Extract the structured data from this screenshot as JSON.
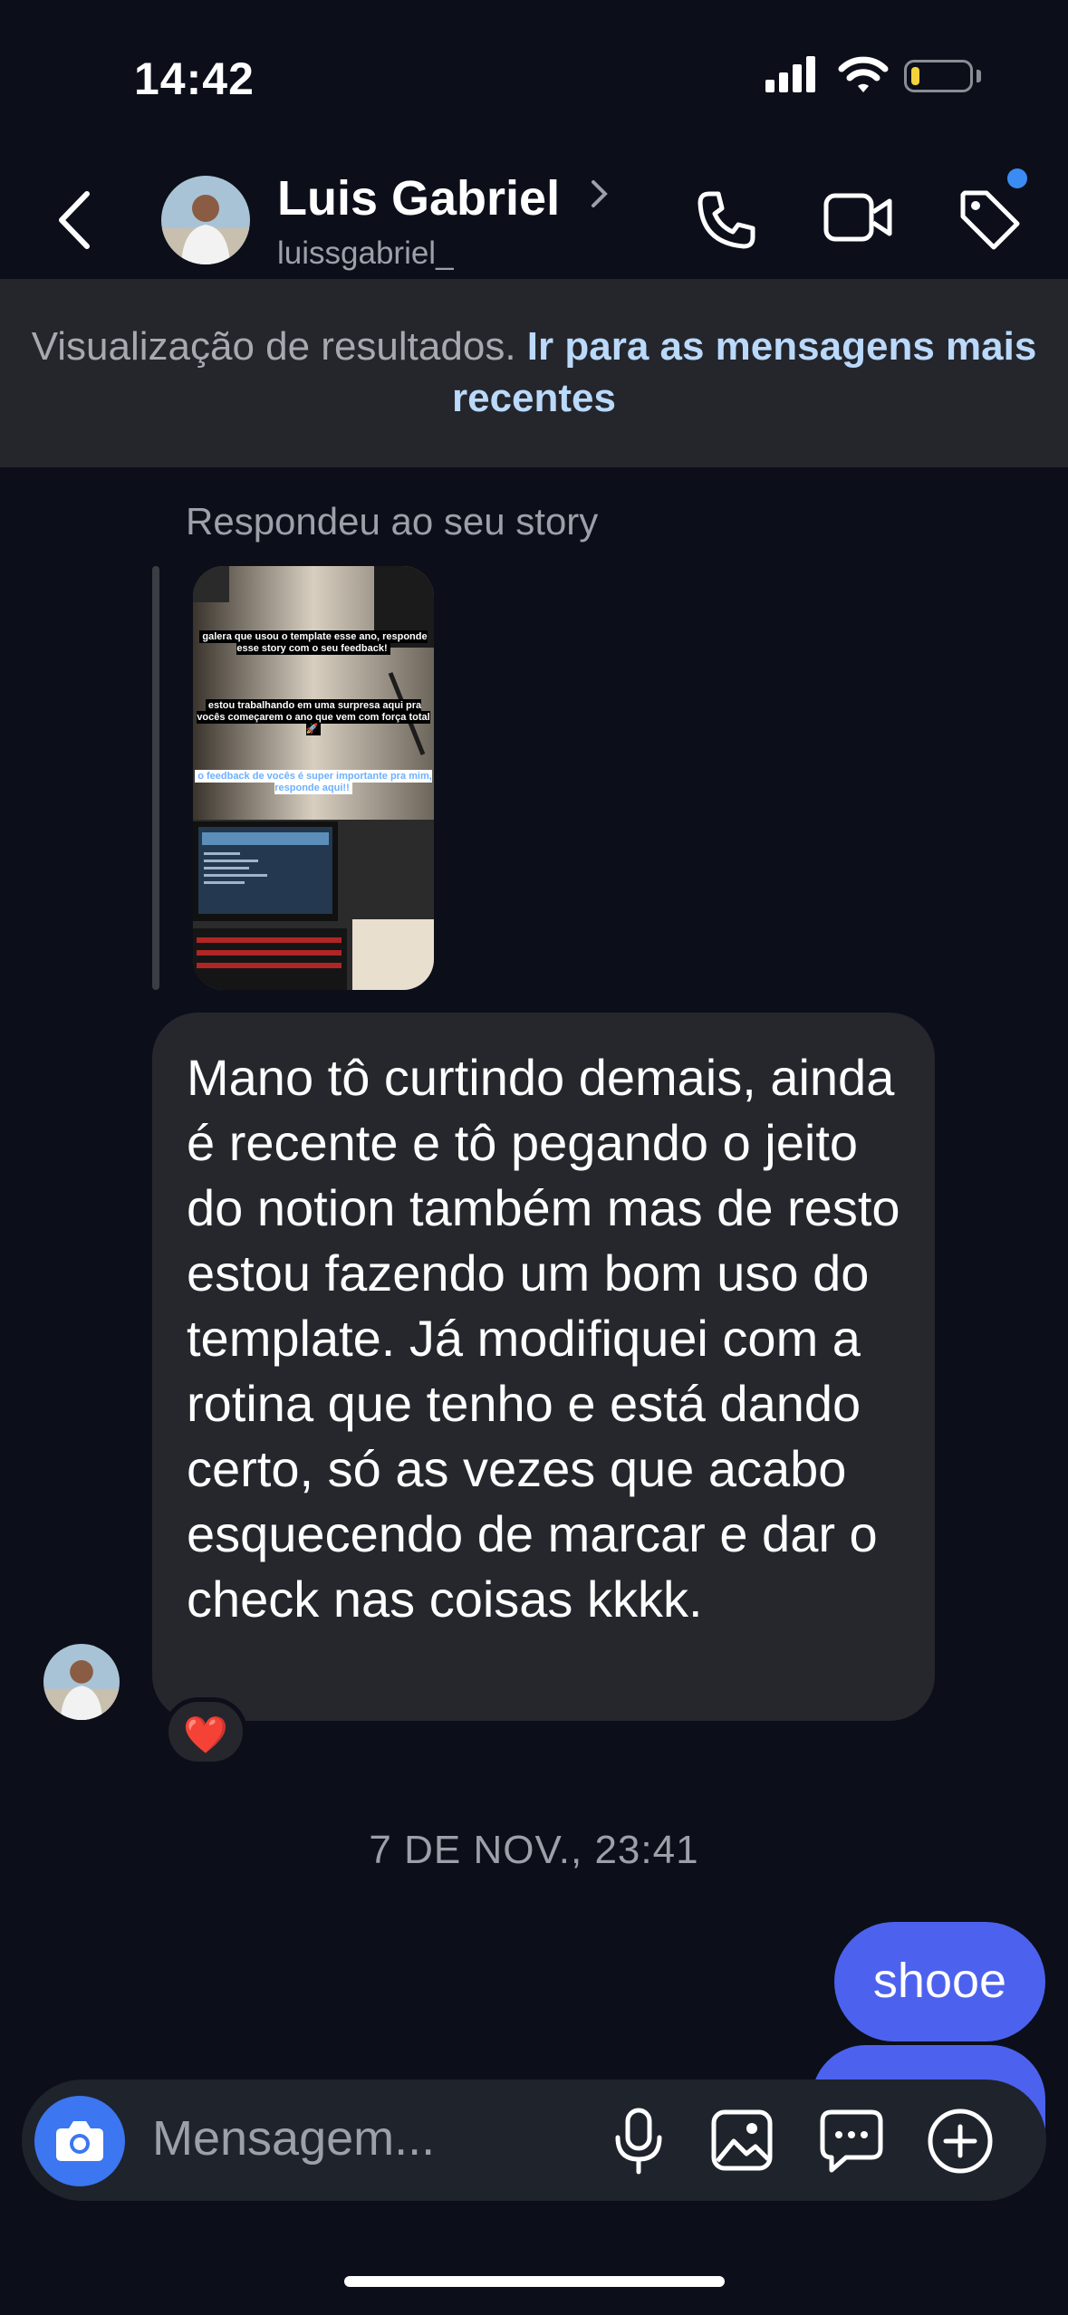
{
  "status_bar": {
    "time": "14:42"
  },
  "header": {
    "contact_name": "Luis Gabriel",
    "contact_handle": "luissgabriel_"
  },
  "banner": {
    "text": "Visualização de resultados.",
    "link": "Ir para as mensagens mais recentes"
  },
  "thread": {
    "reply_label": "Respondeu ao seu story",
    "story_text": {
      "line1": "galera que usou o template esse ano, responde esse story com o seu feedback!",
      "line2": "estou trabalhando em uma surpresa aqui pra vocês começarem o ano que vem com força total 🚀",
      "line3": "o feedback de vocês é super importante pra mim, responde aqui!!"
    },
    "message": "Mano tô curtindo demais, ainda é recente e tô pegando o jeito do notion também mas de resto estou fazendo um bom uso do template. Já modifiquei com a rotina que tenho e está dando certo, só as vezes que acabo esquecendo de marcar e dar o check nas coisas kkkk.",
    "reaction": "❤️",
    "date_divider": "7 DE NOV., 23:41",
    "sent_message": "shooe"
  },
  "composer": {
    "placeholder": "Mensagem..."
  },
  "colors": {
    "background": "#0c0f19",
    "incoming_bubble": "#25272d",
    "outgoing_bubble": "#4c62ee",
    "link": "#bad9fb",
    "camera_button": "#3c76f0"
  },
  "icons": [
    "back-icon",
    "chevron-right-icon",
    "phone-icon",
    "video-icon",
    "tag-icon",
    "camera-icon",
    "microphone-icon",
    "gallery-icon",
    "sticker-icon",
    "plus-icon"
  ]
}
